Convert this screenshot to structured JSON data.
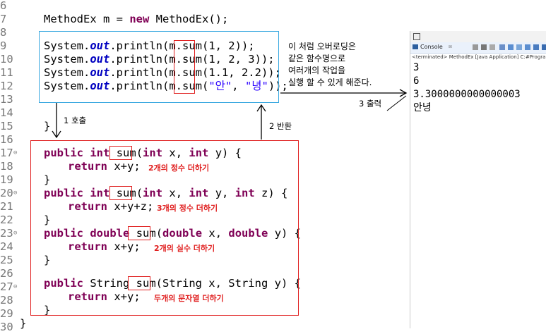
{
  "line_numbers": [
    "6",
    "7",
    "8",
    "9",
    "10",
    "11",
    "12",
    "13",
    "14",
    "15",
    "16",
    "17",
    "18",
    "19",
    "20",
    "21",
    "22",
    "23",
    "24",
    "25",
    "26",
    "27",
    "28",
    "29",
    "30"
  ],
  "code": {
    "line7": {
      "type": "MethodEx",
      "var": " m = ",
      "new": "new",
      "rest": " MethodEx();"
    },
    "calls": [
      {
        "pre": "System.",
        "out": "out",
        "mid": ".println(m.",
        "sum": "sum",
        "args": "(1, 2));"
      },
      {
        "pre": "System.",
        "out": "out",
        "mid": ".println(m.",
        "sum": "sum",
        "args": "(1, 2, 3));"
      },
      {
        "pre": "System.",
        "out": "out",
        "mid": ".println(m.",
        "sum": "sum",
        "args": "(1.1, 2.2));"
      },
      {
        "pre": "System.",
        "out": "out",
        "mid": ".println(m.",
        "sum": "sum",
        "args_open": "(",
        "s1": "\"안\"",
        "comma": ", ",
        "s2": "\"녕\"",
        "args_close": "));"
      }
    ],
    "line15": "}",
    "methods": [
      {
        "public": "public",
        "type": "int",
        "sum": "sum",
        "params_a": "(",
        "t1": "int",
        "p1": " x, ",
        "t2": "int",
        "p2": " y) {",
        "ret": "return",
        "expr": " x+y;",
        "close": "}"
      },
      {
        "public": "public",
        "type": "int",
        "sum": "sum",
        "params_a": "(",
        "t1": "int",
        "p1": " x, ",
        "t2": "int",
        "p2": " y, ",
        "t3": "int",
        "p3": " z) {",
        "ret": "return",
        "expr": " x+y+z;",
        "close": "}"
      },
      {
        "public": "public",
        "type": "double",
        "sum": "sum",
        "params_a": "(",
        "t1": "double",
        "p1": " x, ",
        "t2": "double",
        "p2": " y) {",
        "ret": "return",
        "expr": " x+y;",
        "close": "}"
      },
      {
        "public": "public",
        "type": " String ",
        "sum": "sum",
        "params_a": "(String x, String y) {",
        "ret": "return",
        "expr": " x+y;",
        "close": "}"
      }
    ],
    "line30": "}"
  },
  "annotations": {
    "note_lines": "이 처럼 오버로딩은\n같은 함수명으로\n여러개의 작업을\n실행 할 수 있게 해준다.",
    "call_label": "1 호출",
    "return_label": "2 반환",
    "output_label": "3 출력",
    "comments": [
      "2개의 정수 더하기",
      "3개의 정수 더하기",
      "2개의 실수 더하기",
      "두개의 문자열 더하기"
    ]
  },
  "console": {
    "tab_label": "Console",
    "status": "<terminated> MethodEx [Java Application] C:#Program Files#Ja",
    "output": [
      "3",
      "6",
      "3.3000000000000003",
      "안녕"
    ]
  },
  "colors": {
    "blue_box": "#39a8e0",
    "red": "#e02020",
    "keyword": "#7f0055",
    "static_field": "#0000c0",
    "string": "#2a00ff"
  }
}
